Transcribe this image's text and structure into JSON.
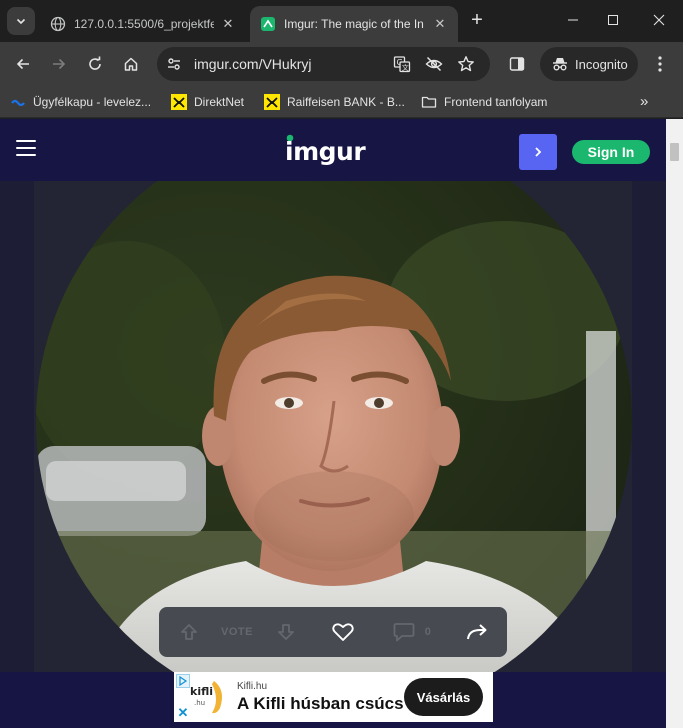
{
  "browser": {
    "tabs": [
      {
        "title": "127.0.0.1:5500/6_projektfe",
        "favicon": "globe-icon",
        "active": false
      },
      {
        "title": "Imgur: The magic of the In",
        "favicon": "imgur-favicon",
        "active": true
      }
    ],
    "address": "imgur.com/VHukryj",
    "incognito_label": "Incognito",
    "bookmarks": [
      {
        "label": "Ügyfélkapu - levelez...",
        "icon": "ugyfelkapu-icon"
      },
      {
        "label": "DirektNet",
        "icon": "raiffeisen-icon"
      },
      {
        "label": "Raiffeisen BANK - B...",
        "icon": "raiffeisen-icon"
      },
      {
        "label": "Frontend tanfolyam",
        "icon": "folder-icon"
      }
    ],
    "bookmarks_overflow": "»"
  },
  "site": {
    "logo_text": "imgur",
    "signin_label": "Sign In",
    "colors": {
      "header": "#171544",
      "signin": "#1bb76e",
      "next": "#5865f2"
    }
  },
  "post": {
    "vote_label": "VOTE",
    "comment_count": "0"
  },
  "ad": {
    "logo_text": "kifli",
    "logo_sub": ".hu",
    "domain": "Kifli.hu",
    "headline": "A Kifli húsban csúcs",
    "cta": "Vásárlás"
  }
}
